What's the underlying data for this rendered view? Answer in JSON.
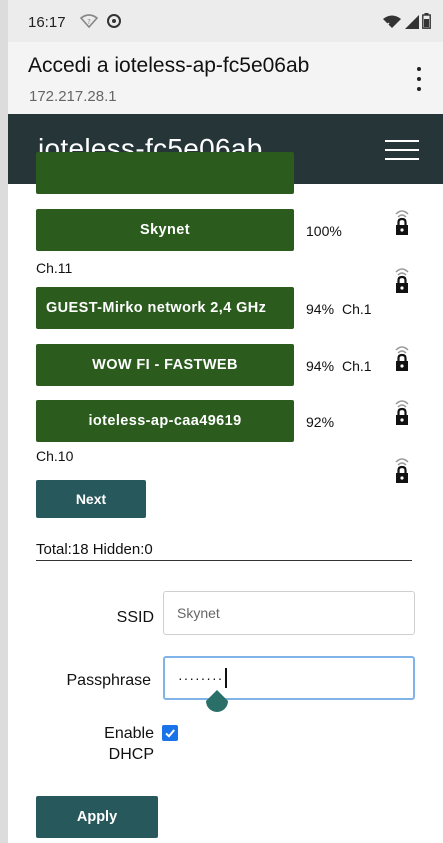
{
  "status_bar": {
    "time": "16:17",
    "left_icons": [
      "wifi-question-icon",
      "data-saver-icon"
    ],
    "right_icons": [
      "wifi-x-icon",
      "signal-icon",
      "battery-icon"
    ]
  },
  "browser": {
    "title": "Accedi a ioteless-ap-fc5e06ab",
    "url": "172.217.28.1",
    "menu_icon": "more-vert-icon"
  },
  "navbar": {
    "title": "ioteless-fc5e06ab",
    "menu_icon": "hamburger-icon"
  },
  "networks": [
    {
      "ssid": "",
      "signal": "",
      "channel": ""
    },
    {
      "ssid": "Skynet",
      "signal": "100%",
      "channel": "Ch.11"
    },
    {
      "ssid": "GUEST-Mirko network 2,4 GHz",
      "signal": "94%",
      "channel": "Ch.1"
    },
    {
      "ssid": "WOW FI - FASTWEB",
      "signal": "94%",
      "channel": "Ch.1"
    },
    {
      "ssid": "ioteless-ap-caa49619",
      "signal": "92%",
      "channel": "Ch.10"
    }
  ],
  "next_label": "Next",
  "total_text": "Total:18 Hidden:0",
  "form": {
    "ssid_label": "SSID",
    "ssid_value": "Skynet",
    "pass_label": "Passphrase",
    "pass_value": "········",
    "dhcp_label_1": "Enable",
    "dhcp_label_2": "DHCP",
    "dhcp_checked": true,
    "apply_label": "Apply"
  },
  "colors": {
    "navbar": "#263638",
    "network_button": "#2b5c1e",
    "action_button": "#27585c",
    "checkbox": "#1a73e8",
    "focus_border": "#80b4e6",
    "text_handle": "#2b7068"
  }
}
